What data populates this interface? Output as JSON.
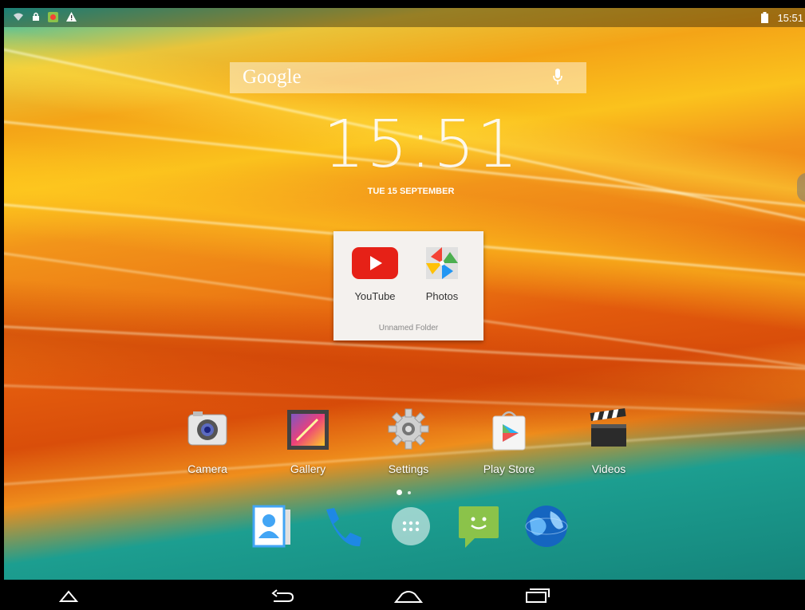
{
  "status_bar": {
    "left_icons": [
      "wifi-icon",
      "lock-icon",
      "app-notification-icon",
      "warning-icon"
    ],
    "right_icons": [
      "battery-icon"
    ],
    "time": "15:51"
  },
  "search": {
    "brand": "Google",
    "mic_icon": "mic-icon"
  },
  "clock": {
    "time": "15:51",
    "date": "TUE 15 SEPTEMBER"
  },
  "folder": {
    "name": "Unnamed Folder",
    "apps": [
      {
        "label": "YouTube",
        "icon": "youtube-icon"
      },
      {
        "label": "Photos",
        "icon": "photos-icon"
      }
    ]
  },
  "apps": [
    {
      "label": "Camera",
      "icon": "camera-icon"
    },
    {
      "label": "Gallery",
      "icon": "gallery-icon"
    },
    {
      "label": "Settings",
      "icon": "settings-gear-icon"
    },
    {
      "label": "Play Store",
      "icon": "play-store-icon"
    },
    {
      "label": "Videos",
      "icon": "clapperboard-icon"
    }
  ],
  "page_indicator": {
    "pages": 2,
    "current": 1
  },
  "dock": [
    "contacts-icon",
    "phone-icon",
    "app-drawer-icon",
    "messaging-icon",
    "browser-globe-icon"
  ],
  "nav": [
    "home-outline-icon",
    "back-icon",
    "home-icon",
    "recent-apps-icon"
  ],
  "colors": {
    "accent_teal": "#2bc3b6",
    "accent_orange": "#f4a417",
    "youtube_red": "#e62117"
  }
}
